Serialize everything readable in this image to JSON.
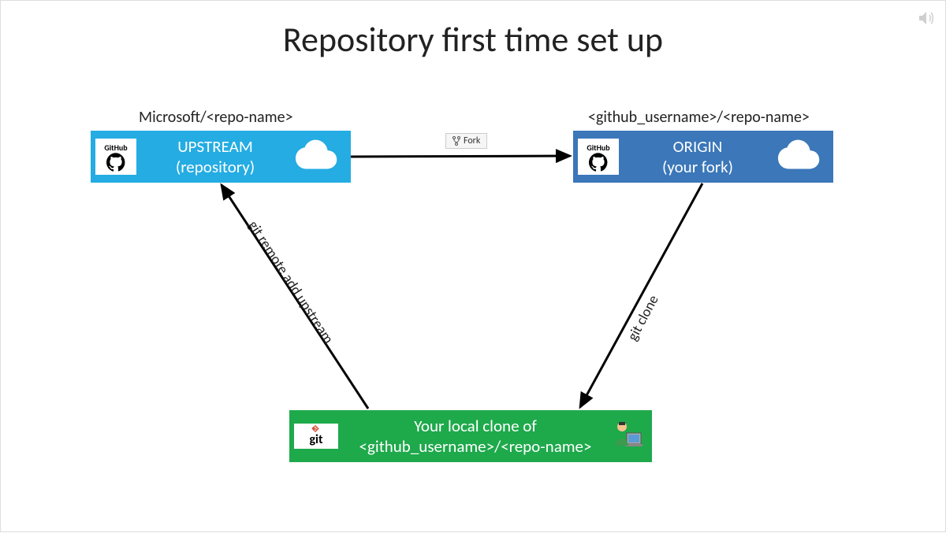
{
  "title": "Repository first time set up",
  "upstream": {
    "path_label": "Microsoft/<repo-name>",
    "line1": "UPSTREAM",
    "line2": "(repository)",
    "badge": "GitHub"
  },
  "origin": {
    "path_label": "<github_username>/<repo-name>",
    "line1": "ORIGIN",
    "line2": "(your fork)",
    "badge": "GitHub"
  },
  "local": {
    "line1": "Your local clone of",
    "line2": "<github_username>/<repo-name>",
    "badge": "git"
  },
  "arrows": {
    "fork_label": "Fork",
    "remote_add_label": "git remote add upstream",
    "clone_label": "git clone"
  },
  "colors": {
    "upstream": "#24ace3",
    "origin": "#3b77b9",
    "local": "#1ea94b"
  }
}
